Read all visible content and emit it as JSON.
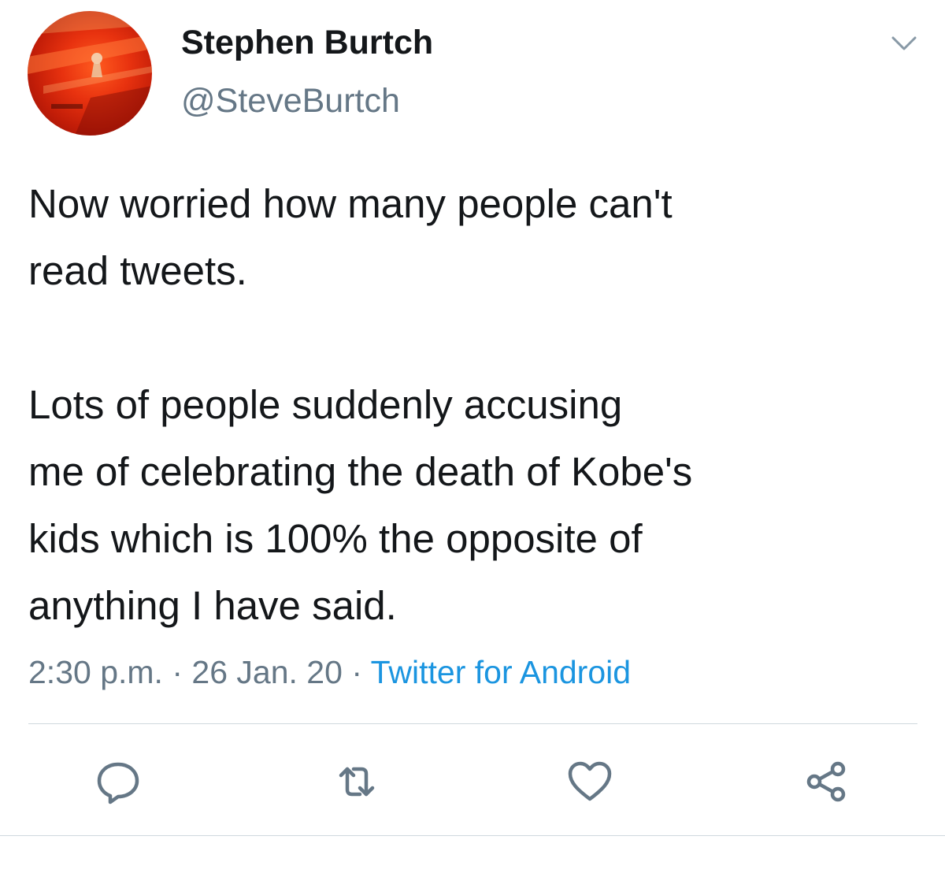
{
  "author": {
    "display_name": "Stephen Burtch",
    "handle": "@SteveBurtch",
    "avatar_icon": "profile-photo"
  },
  "tweet": {
    "paragraphs": [
      "Now worried how many people can't\nread tweets.",
      "Lots of people suddenly accusing\nme of celebrating the death of Kobe's\nkids which is 100% the opposite of\nanything I have said."
    ]
  },
  "meta": {
    "time": "2:30 p.m.",
    "separator": "·",
    "date": "26 Jan. 20",
    "source": "Twitter for Android"
  },
  "actions": {
    "reply_icon": "reply-icon",
    "retweet_icon": "retweet-icon",
    "like_icon": "heart-icon",
    "share_icon": "share-icon"
  },
  "colors": {
    "text": "#14171a",
    "secondary": "#657786",
    "link": "#1b95e0",
    "divider": "#cfd9de"
  }
}
